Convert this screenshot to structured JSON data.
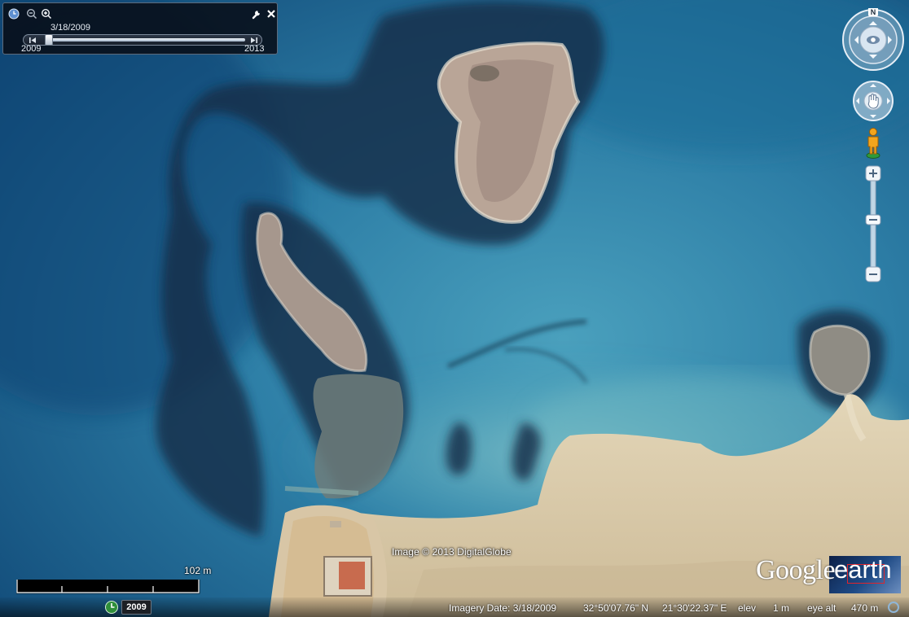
{
  "time_slider": {
    "date_label": "3/18/2009",
    "start_year": "2009",
    "end_year": "2013",
    "position": 0.02,
    "icons": [
      "clock-icon",
      "zoom-out-icon",
      "zoom-in-icon",
      "wrench-icon",
      "close-icon",
      "step-back-icon",
      "step-forward-icon"
    ]
  },
  "navigation": {
    "compass_label": "N",
    "icons": [
      "look-around-icon",
      "move-hand-icon",
      "pegman-icon",
      "zoom-plus-icon",
      "zoom-minus-icon"
    ],
    "zoom_level": 0.42
  },
  "scale": {
    "label": "102 m"
  },
  "copyright": "Image © 2013 DigitalGlobe",
  "logo": {
    "google": "Google",
    "earth": "earth"
  },
  "status": {
    "year_chip": "2009",
    "imagery_date": "Imagery Date: 3/18/2009",
    "lat": "32°50'07.76\" N",
    "lon": "21°30'22.37\" E",
    "elev_label": "elev",
    "elev_value": "1 m",
    "eye_alt_label": "eye alt",
    "eye_alt_value": "470 m"
  },
  "colors": {
    "deep_water": "#14527f",
    "shallow_water": "#3e8fae",
    "sand": "#d8c9a8",
    "rock": "#9a8a7c",
    "reef": "#13304a"
  }
}
